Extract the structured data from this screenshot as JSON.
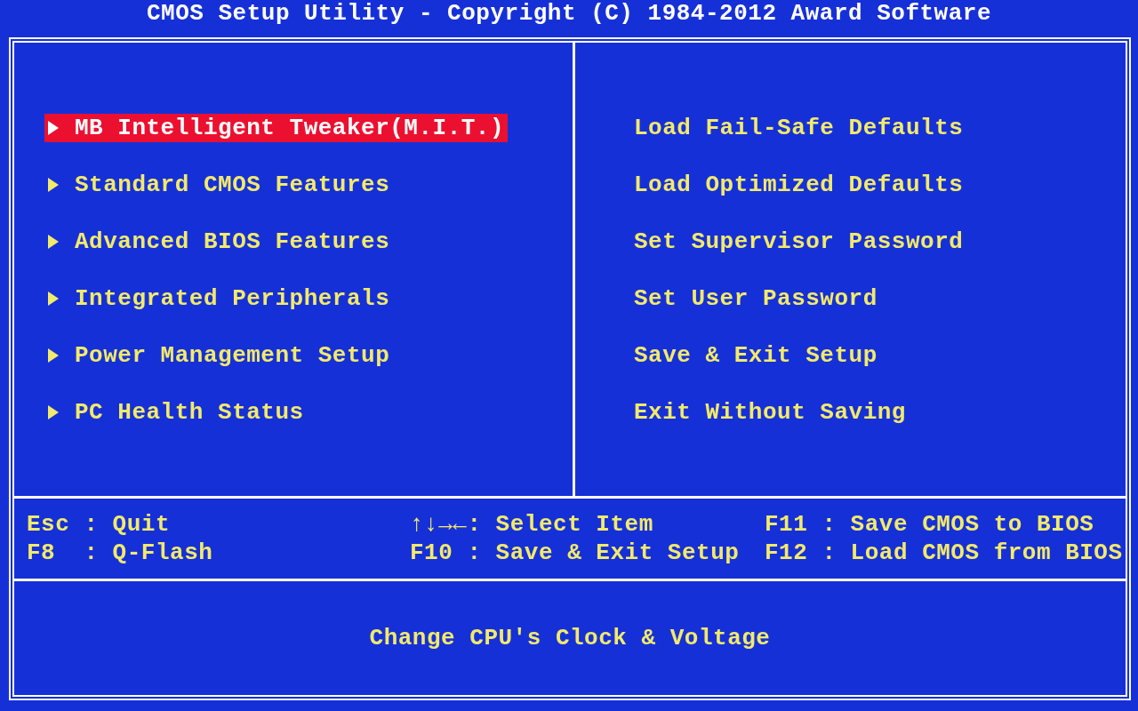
{
  "window": {
    "title": "CMOS Setup Utility - Copyright (C) 1984-2012 Award Software"
  },
  "left_menu": [
    {
      "label": "MB Intelligent Tweaker(M.I.T.)",
      "selected": true
    },
    {
      "label": "Standard CMOS Features",
      "selected": false
    },
    {
      "label": "Advanced BIOS Features",
      "selected": false
    },
    {
      "label": "Integrated Peripherals",
      "selected": false
    },
    {
      "label": "Power Management Setup",
      "selected": false
    },
    {
      "label": "PC Health Status",
      "selected": false
    }
  ],
  "right_menu": [
    {
      "label": "Load Fail-Safe Defaults",
      "selected": false
    },
    {
      "label": "Load Optimized Defaults",
      "selected": false
    },
    {
      "label": "Set Supervisor Password",
      "selected": false
    },
    {
      "label": "Set User Password",
      "selected": false
    },
    {
      "label": "Save & Exit Setup",
      "selected": false
    },
    {
      "label": "Exit Without Saving",
      "selected": false
    }
  ],
  "key_help": [
    {
      "text": "Esc : Quit"
    },
    {
      "text": "↑↓→←: Select Item"
    },
    {
      "text": "F11 : Save CMOS to BIOS"
    },
    {
      "text": "F8  : Q-Flash"
    },
    {
      "text": "F10 : Save & Exit Setup"
    },
    {
      "text": "F12 : Load CMOS from BIOS"
    }
  ],
  "status_bar": {
    "text": "Change CPU's Clock & Voltage"
  }
}
